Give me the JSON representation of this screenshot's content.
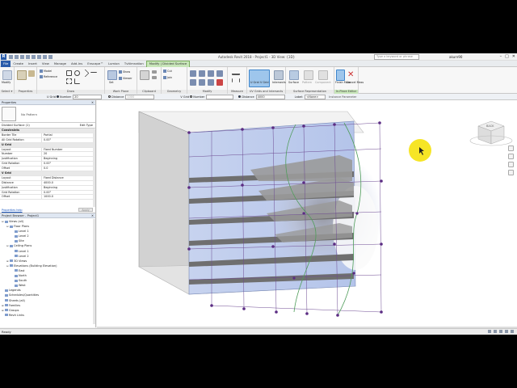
{
  "app": {
    "logo": "R",
    "window_title": "Autodesk Revit 2018 - Project1 - 3D View: {3D}",
    "search_placeholder": "Type a keyword or phrase",
    "user": "akurn90",
    "controls": [
      "–",
      "□",
      "✕"
    ]
  },
  "tabs": [
    "File",
    "Create",
    "Insert",
    "View",
    "Manage",
    "Add-Ins",
    "Enscape™",
    "Lumion",
    "Tvitimnation",
    "Modify | Divided Surface"
  ],
  "ribbon": {
    "modify_label": "Modify",
    "model_label": "Model",
    "reference_label": "Reference",
    "set_label": "Set",
    "show_label": "Show",
    "viewer_label": "Viewer",
    "cut_label": "Cut",
    "join_label": "Join",
    "ugrid_label": "U Grid",
    "vgrid_label": "V Grid",
    "intersects_label": "Intersects",
    "surface_label": "Surface",
    "pattern_label": "Pattern",
    "component_label": "Component",
    "finish_label": "Finish Mass",
    "cancel_label": "Cancel Mass",
    "panels": [
      "Select ▾",
      "Properties",
      "Draw",
      "Work Plane",
      "Clipboard",
      "Geometry",
      "Modify",
      "Measure",
      "UV Grids and Intersects",
      "Surface Representation",
      "In-Place Editor"
    ]
  },
  "options_bar": {
    "ugrid": "U Grid",
    "number_u": "Number",
    "number_u_value": "20",
    "distance_u": "Distance",
    "distance_u_value": "1000",
    "vgrid": "V Grid",
    "number_v": "Number",
    "distance_v": "Distance",
    "distance_v_value": "4000",
    "label_text": "Label:",
    "label_value": "<None>",
    "instance_parameter": "Instance Parameter"
  },
  "properties": {
    "title": "Properties",
    "type_name": "No Pattern",
    "instance": "Divided Surface (1)",
    "edit_type": "Edit Type",
    "rows": [
      {
        "group": "Constraints"
      },
      {
        "k": "Border Tile",
        "v": "Partial"
      },
      {
        "k": "All Grid Rotation",
        "v": "0.00°"
      },
      {
        "group": "U Grid"
      },
      {
        "k": "Layout",
        "v": "Fixed Number"
      },
      {
        "k": "Number",
        "v": "20"
      },
      {
        "k": "Justification",
        "v": "Beginning"
      },
      {
        "k": "Grid Rotation",
        "v": "0.00°"
      },
      {
        "k": "Offset",
        "v": "0.0"
      },
      {
        "group": "V Grid"
      },
      {
        "k": "Layout",
        "v": "Fixed Distance"
      },
      {
        "k": "Distance",
        "v": "4000.0"
      },
      {
        "k": "Justification",
        "v": "Beginning"
      },
      {
        "k": "Grid Rotation",
        "v": "0.00°"
      },
      {
        "k": "Offset",
        "v": "1000.0"
      }
    ],
    "help": "Properties help",
    "apply": "Apply"
  },
  "project_browser": {
    "title": "Project Browser - Project1",
    "nodes": [
      {
        "label": "Views (all)",
        "depth": 0,
        "toggle": "⊟"
      },
      {
        "label": "Floor Plans",
        "depth": 1,
        "toggle": "⊟"
      },
      {
        "label": "Level 1",
        "depth": 2,
        "toggle": ""
      },
      {
        "label": "Level 2",
        "depth": 2,
        "toggle": ""
      },
      {
        "label": "Site",
        "depth": 2,
        "toggle": ""
      },
      {
        "label": "Ceiling Plans",
        "depth": 1,
        "toggle": "⊟"
      },
      {
        "label": "Level 1",
        "depth": 2,
        "toggle": ""
      },
      {
        "label": "Level 2",
        "depth": 2,
        "toggle": ""
      },
      {
        "label": "3D Views",
        "depth": 1,
        "toggle": "⊞"
      },
      {
        "label": "Elevations (Building Elevation)",
        "depth": 1,
        "toggle": "⊟"
      },
      {
        "label": "East",
        "depth": 2,
        "toggle": ""
      },
      {
        "label": "North",
        "depth": 2,
        "toggle": ""
      },
      {
        "label": "South",
        "depth": 2,
        "toggle": ""
      },
      {
        "label": "West",
        "depth": 2,
        "toggle": ""
      },
      {
        "label": "Legends",
        "depth": 0,
        "toggle": ""
      },
      {
        "label": "Schedules/Quantities",
        "depth": 0,
        "toggle": ""
      },
      {
        "label": "Sheets (all)",
        "depth": 0,
        "toggle": ""
      },
      {
        "label": "Families",
        "depth": 0,
        "toggle": "⊞"
      },
      {
        "label": "Groups",
        "depth": 0,
        "toggle": "⊞"
      },
      {
        "label": "Revit Links",
        "depth": 0,
        "toggle": ""
      }
    ]
  },
  "viewcube": {
    "face": "BACK"
  },
  "status": {
    "text": "Ready"
  },
  "colors": {
    "accent": "#2a5caa",
    "active_tab": "#c8e6b9",
    "cursor_highlight": "#f5e000",
    "grid_node": "#5b2c83"
  }
}
